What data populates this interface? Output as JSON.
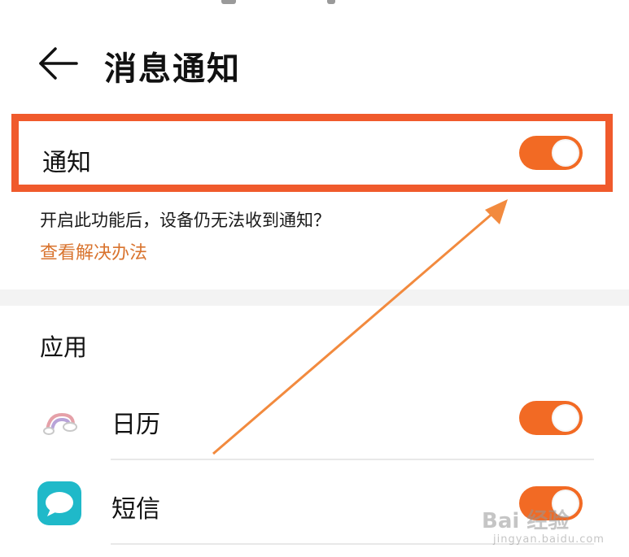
{
  "header": {
    "title": "消息通知",
    "back_icon": "arrow-left-icon"
  },
  "notification_toggle": {
    "label": "通知",
    "state": "on"
  },
  "hint": {
    "text": "开启此功能后，设备仍无法收到通知？",
    "link": "查看解决办法"
  },
  "apps_section": {
    "title": "应用",
    "items": [
      {
        "name": "日历",
        "icon": "calendar-rainbow-icon",
        "state": "on"
      },
      {
        "name": "短信",
        "icon": "messages-bubble-icon",
        "state": "on"
      }
    ]
  },
  "watermark": {
    "main": "Bai 经验",
    "sub": "jingyan.baidu.com"
  },
  "colors": {
    "accent": "#f26a24",
    "highlight_box": "#f05a2c",
    "link": "#d9742f",
    "arrow": "#f28a3e"
  }
}
